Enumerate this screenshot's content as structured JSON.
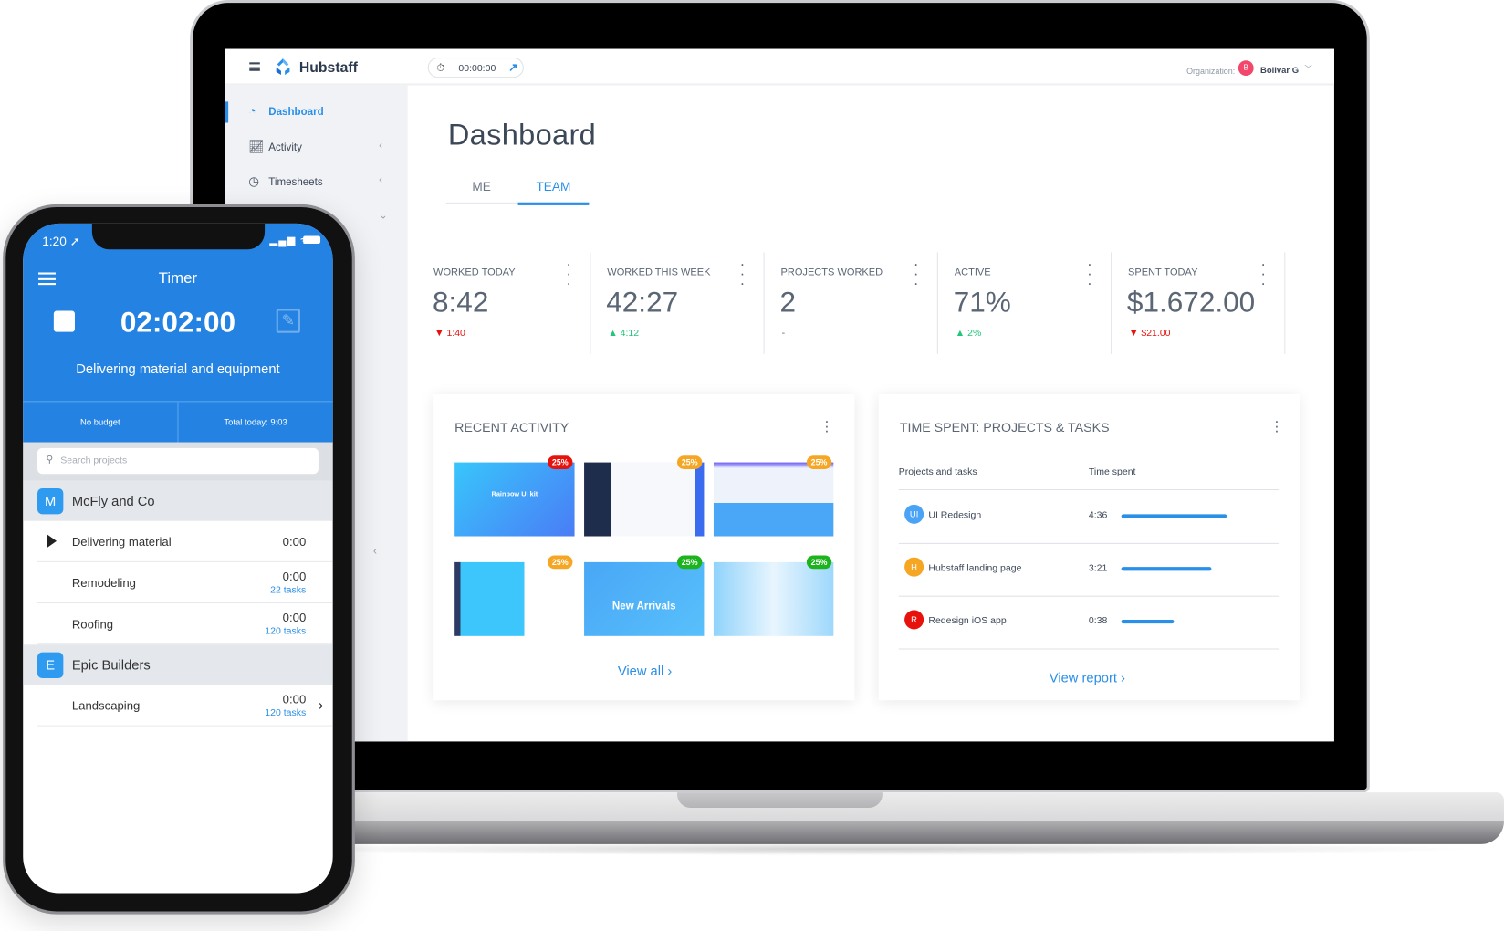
{
  "laptop": {
    "topbar": {
      "brand": "Hubstaff",
      "timer": "00:00:00",
      "org_label": "Organization:",
      "org_avatar": "B",
      "org_user": "Bolivar G"
    },
    "sidebar": {
      "items": [
        {
          "label": "Dashboard",
          "icon": "dashboard-icon",
          "active": true
        },
        {
          "label": "Activity",
          "icon": "activity-chart-icon"
        },
        {
          "label": "Timesheets",
          "icon": "clock-icon"
        }
      ]
    },
    "page_title": "Dashboard",
    "tabs": [
      {
        "label": "ME"
      },
      {
        "label": "TEAM",
        "active": true
      }
    ],
    "stats": [
      {
        "label": "WORKED TODAY",
        "value": "8:42",
        "change": "1:40",
        "direction": "down"
      },
      {
        "label": "WORKED THIS WEEK",
        "value": "42:27",
        "change": "4:12",
        "direction": "up"
      },
      {
        "label": "PROJECTS WORKED",
        "value": "2",
        "change": "-",
        "direction": "none"
      },
      {
        "label": "ACTIVE",
        "value": "71%",
        "change": "2%",
        "direction": "up"
      },
      {
        "label": "SPENT TODAY",
        "value": "$1.672.00",
        "change": "$21.00",
        "direction": "down"
      }
    ],
    "recent_activity": {
      "title": "RECENT ACTIVITY",
      "thumbnails": [
        {
          "badge": "25%",
          "badge_color": "#e8120c",
          "caption": "Rainbow UI kit"
        },
        {
          "badge": "25%",
          "badge_color": "#f5a623",
          "caption": ""
        },
        {
          "badge": "25%",
          "badge_color": "#f5a623",
          "caption": ""
        },
        {
          "badge": "25%",
          "badge_color": "#f5a623",
          "caption": ""
        },
        {
          "badge": "25%",
          "badge_color": "#1db31d",
          "caption": "New Arrivals"
        },
        {
          "badge": "25%",
          "badge_color": "#1db31d",
          "caption": ""
        }
      ],
      "view_all": "View all ›"
    },
    "time_spent": {
      "title": "TIME SPENT: PROJECTS & TASKS",
      "col_project": "Projects and tasks",
      "col_time": "Time spent",
      "rows": [
        {
          "avatar": "UI",
          "color": "#4aa3f5",
          "name": "UI Redesign",
          "time": "4:36",
          "fraction": 1.0
        },
        {
          "avatar": "H",
          "color": "#f5a623",
          "name": "Hubstaff landing page",
          "time": "3:21",
          "fraction": 0.85
        },
        {
          "avatar": "R",
          "color": "#e8120c",
          "name": "Redesign iOS app",
          "time": "0:38",
          "fraction": 0.5
        }
      ],
      "view_report": "View report ›"
    }
  },
  "phone": {
    "status_time": "1:20 ➚",
    "status_icons": "▂▄▆ ᯤ",
    "title": "Timer",
    "clock": "02:02:00",
    "task_desc": "Delivering material and equipment",
    "budget": "No budget",
    "total_today": "Total today: 9:03",
    "search_placeholder": "Search projects",
    "groups": [
      {
        "initial": "M",
        "name": "McFly and Co",
        "tasks": [
          {
            "name": "Delivering material",
            "time": "0:00",
            "tasks": "",
            "playing": true
          },
          {
            "name": "Remodeling",
            "time": "0:00",
            "tasks": "22 tasks"
          },
          {
            "name": "Roofing",
            "time": "0:00",
            "tasks": "120 tasks"
          }
        ]
      },
      {
        "initial": "E",
        "name": "Epic Builders",
        "tasks": [
          {
            "name": "Landscaping",
            "time": "0:00",
            "tasks": "120 tasks",
            "chevron": true
          }
        ]
      }
    ]
  }
}
